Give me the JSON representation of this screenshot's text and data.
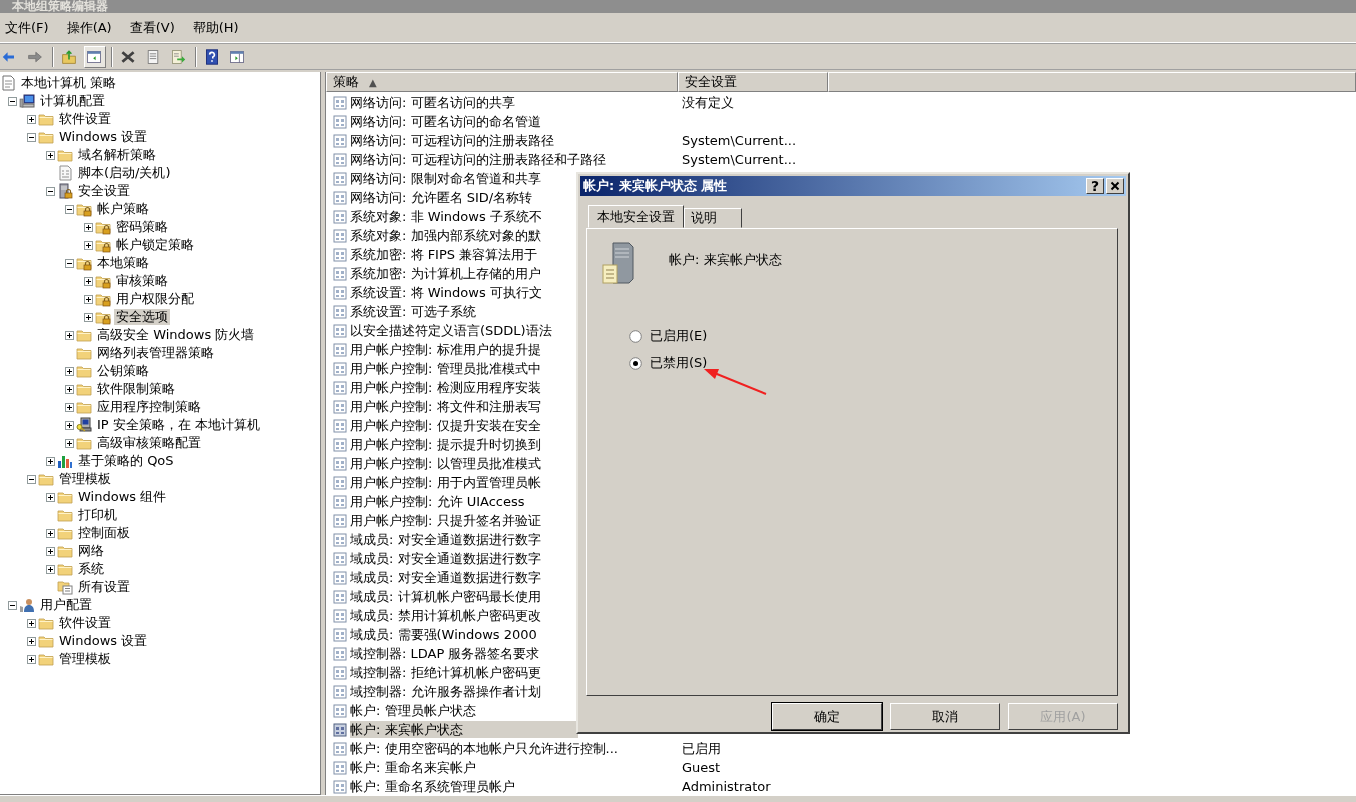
{
  "window": {
    "title": "本地组策略编辑器"
  },
  "menu": [
    "文件(F)",
    "操作(A)",
    "查看(V)",
    "帮助(H)"
  ],
  "toolbar": [
    {
      "kind": "back"
    },
    {
      "kind": "forward"
    },
    {
      "kind": "sep"
    },
    {
      "kind": "up"
    },
    {
      "kind": "tree",
      "selected": true
    },
    {
      "kind": "sep"
    },
    {
      "kind": "delete"
    },
    {
      "kind": "properties"
    },
    {
      "kind": "export"
    },
    {
      "kind": "sep"
    },
    {
      "kind": "help"
    },
    {
      "kind": "actionpane"
    }
  ],
  "tree": [
    {
      "label": "本地计算机 策略",
      "kind": "policy",
      "selected": false,
      "children": [
        {
          "label": "计算机配置",
          "kind": "computer",
          "expanded": true,
          "selected": false,
          "children": [
            {
              "label": "软件设置",
              "kind": "folder",
              "expanded": false,
              "selected": false
            },
            {
              "label": "Windows 设置",
              "kind": "folder",
              "expanded": true,
              "selected": false,
              "children": [
                {
                  "label": "域名解析策略",
                  "kind": "folder",
                  "expanded": false,
                  "selected": false
                },
                {
                  "label": "脚本(启动/关机)",
                  "kind": "script",
                  "selected": false
                },
                {
                  "label": "安全设置",
                  "kind": "serverlock",
                  "expanded": true,
                  "selected": false,
                  "children": [
                    {
                      "label": "帐户策略",
                      "kind": "lockfolder",
                      "expanded": true,
                      "selected": false,
                      "children": [
                        {
                          "label": "密码策略",
                          "kind": "lockfolder",
                          "expanded": false,
                          "selected": false
                        },
                        {
                          "label": "帐户锁定策略",
                          "kind": "lockfolder",
                          "expanded": false,
                          "selected": false
                        }
                      ]
                    },
                    {
                      "label": "本地策略",
                      "kind": "lockfolder",
                      "expanded": true,
                      "selected": false,
                      "children": [
                        {
                          "label": "审核策略",
                          "kind": "lockfolder",
                          "expanded": false,
                          "selected": false
                        },
                        {
                          "label": "用户权限分配",
                          "kind": "lockfolder",
                          "expanded": false,
                          "selected": false
                        },
                        {
                          "label": "安全选项",
                          "kind": "lockfolder",
                          "expanded": false,
                          "selected": true
                        }
                      ]
                    },
                    {
                      "label": "高级安全 Windows 防火墙",
                      "kind": "folder",
                      "expanded": false,
                      "selected": false
                    },
                    {
                      "label": "网络列表管理器策略",
                      "kind": "folder",
                      "selected": false
                    },
                    {
                      "label": "公钥策略",
                      "kind": "folder",
                      "expanded": false,
                      "selected": false
                    },
                    {
                      "label": "软件限制策略",
                      "kind": "folder",
                      "expanded": false,
                      "selected": false
                    },
                    {
                      "label": "应用程序控制策略",
                      "kind": "folder",
                      "expanded": false,
                      "selected": false
                    },
                    {
                      "label": "IP 安全策略，在 本地计算机",
                      "kind": "ip",
                      "expanded": false,
                      "selected": false
                    },
                    {
                      "label": "高级审核策略配置",
                      "kind": "folder",
                      "expanded": false,
                      "selected": false
                    }
                  ]
                },
                {
                  "label": "基于策略的 QoS",
                  "kind": "chart",
                  "expanded": false,
                  "selected": false
                }
              ]
            },
            {
              "label": "管理模板",
              "kind": "folder",
              "expanded": true,
              "selected": false,
              "children": [
                {
                  "label": "Windows 组件",
                  "kind": "folder",
                  "expanded": false,
                  "selected": false
                },
                {
                  "label": "打印机",
                  "kind": "folder",
                  "selected": false
                },
                {
                  "label": "控制面板",
                  "kind": "folder",
                  "expanded": false,
                  "selected": false
                },
                {
                  "label": "网络",
                  "kind": "folder",
                  "expanded": false,
                  "selected": false
                },
                {
                  "label": "系统",
                  "kind": "folder",
                  "expanded": false,
                  "selected": false
                },
                {
                  "label": "所有设置",
                  "kind": "settings",
                  "selected": false
                }
              ]
            }
          ]
        },
        {
          "label": "用户配置",
          "kind": "user",
          "expanded": true,
          "selected": false,
          "children": [
            {
              "label": "软件设置",
              "kind": "folder",
              "expanded": false,
              "selected": false
            },
            {
              "label": "Windows 设置",
              "kind": "folder",
              "expanded": false,
              "selected": false
            },
            {
              "label": "管理模板",
              "kind": "folder",
              "expanded": false,
              "selected": false
            }
          ]
        }
      ]
    }
  ],
  "policy_list": {
    "columns": [
      {
        "label": "策略",
        "sort_indicator": "▲"
      },
      {
        "label": "安全设置"
      }
    ],
    "rows": [
      {
        "policy": "网络访问: 可匿名访问的共享",
        "setting": "没有定义",
        "selected": false
      },
      {
        "policy": "网络访问: 可匿名访问的命名管道",
        "selected": false
      },
      {
        "policy": "网络访问: 可远程访问的注册表路径",
        "setting": "System\\Current...",
        "selected": false
      },
      {
        "policy": "网络访问: 可远程访问的注册表路径和子路径",
        "setting": "System\\Current...",
        "selected": false
      },
      {
        "policy": "网络访问: 限制对命名管道和共享",
        "selected": false
      },
      {
        "policy": "网络访问: 允许匿名 SID/名称转",
        "selected": false
      },
      {
        "policy": "系统对象: 非 Windows 子系统不",
        "selected": false
      },
      {
        "policy": "系统对象: 加强内部系统对象的默",
        "selected": false
      },
      {
        "policy": "系统加密: 将 FIPS 兼容算法用于",
        "selected": false
      },
      {
        "policy": "系统加密: 为计算机上存储的用户",
        "selected": false
      },
      {
        "policy": "系统设置: 将 Windows 可执行文",
        "selected": false
      },
      {
        "policy": "系统设置: 可选子系统",
        "selected": false
      },
      {
        "policy": "以安全描述符定义语言(SDDL)语法",
        "selected": false
      },
      {
        "policy": "用户帐户控制: 标准用户的提升提",
        "selected": false
      },
      {
        "policy": "用户帐户控制: 管理员批准模式中",
        "selected": false
      },
      {
        "policy": "用户帐户控制: 检测应用程序安装",
        "selected": false
      },
      {
        "policy": "用户帐户控制: 将文件和注册表写",
        "selected": false
      },
      {
        "policy": "用户帐户控制: 仅提升安装在安全",
        "selected": false
      },
      {
        "policy": "用户帐户控制: 提示提升时切换到",
        "selected": false
      },
      {
        "policy": "用户帐户控制: 以管理员批准模式",
        "selected": false
      },
      {
        "policy": "用户帐户控制: 用于内置管理员帐",
        "selected": false
      },
      {
        "policy": "用户帐户控制: 允许 UIAccess",
        "selected": false
      },
      {
        "policy": "用户帐户控制: 只提升签名并验证",
        "selected": false
      },
      {
        "policy": "域成员: 对安全通道数据进行数字",
        "selected": false
      },
      {
        "policy": "域成员: 对安全通道数据进行数字",
        "selected": false
      },
      {
        "policy": "域成员: 对安全通道数据进行数字",
        "selected": false
      },
      {
        "policy": "域成员: 计算机帐户密码最长使用",
        "selected": false
      },
      {
        "policy": "域成员: 禁用计算机帐户密码更改",
        "selected": false
      },
      {
        "policy": "域成员: 需要强(Windows 2000",
        "selected": false
      },
      {
        "policy": "域控制器: LDAP 服务器签名要求",
        "selected": false
      },
      {
        "policy": "域控制器: 拒绝计算机帐户密码更",
        "selected": false
      },
      {
        "policy": "域控制器: 允许服务器操作者计划",
        "selected": false
      },
      {
        "policy": "帐户: 管理员帐户状态",
        "selected": false
      },
      {
        "policy": "帐户: 来宾帐户状态",
        "selected": true
      },
      {
        "policy": "帐户: 使用空密码的本地帐户只允许进行控制...",
        "setting": "已启用",
        "selected": false
      },
      {
        "policy": "帐户: 重命名来宾帐户",
        "setting": "Guest",
        "selected": false
      },
      {
        "policy": "帐户: 重命名系统管理员帐户",
        "setting": "Administrator",
        "selected": false
      }
    ]
  },
  "dialog": {
    "title": "帐户: 来宾帐户状态 属性",
    "help_button": "?",
    "tabs": [
      {
        "label": "本地安全设置",
        "selected": true
      },
      {
        "label": "说明",
        "selected": false
      }
    ],
    "heading": "帐户: 来宾帐户状态",
    "options": [
      {
        "label": "已启用(E)",
        "selected": false
      },
      {
        "label": "已禁用(S)",
        "selected": true
      }
    ],
    "buttons": [
      {
        "label": "确定",
        "kind": "default",
        "disabled": false
      },
      {
        "label": "取消",
        "kind": "normal",
        "disabled": false
      },
      {
        "label": "应用(A)",
        "kind": "normal",
        "disabled": true
      }
    ]
  }
}
